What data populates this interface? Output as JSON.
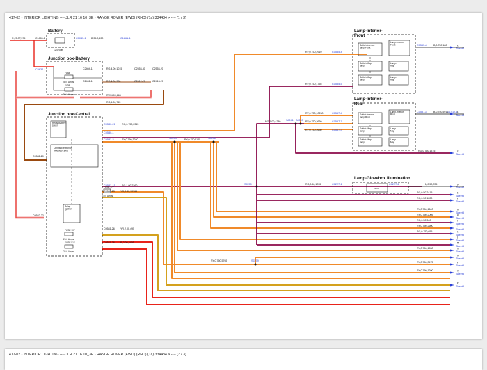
{
  "pages": [
    {
      "header": "417-02 - INTERIOR LIGHTING ---- JLR 21 16 10_3E - RANGE ROVER (EWD) (RHD) (1a) 334434 > ---- (1 / 3)"
    },
    {
      "header": "417-02 - INTERIOR LIGHTING ---- JLR 21 16 10_3E - RANGE ROVER (EWD) (RHD) (1a) 334434 > ---- (2 / 3)"
    }
  ],
  "blocks": {
    "battery": "Battery",
    "jbox_battery": "Junction box-Battery",
    "jbox_central": "Junction box-Central",
    "lamp_front": "Lamp-Interior-\nFront",
    "lamp_rear": "Lamp-Interior-\nRear",
    "lamp_glovebox": "Lamp-Glovebox illumination"
  },
  "components": {
    "relay_battery_saver": "Relay-Battery-\nsaver",
    "cem": "Central Electronics\nModule (CEM)",
    "relay_ignition": "Relay-\nIgnition",
    "sw_front_lamp": "Switch-Interior-\nlamp-Front",
    "sw_map_1": "Switch-Map-\nlamp",
    "lamp_map_1": "Lamp-\nMap",
    "sw_map_2": "Switch-Map-\nlamp",
    "lamp_map_2": "Lamp-\nMap",
    "lamp_front_inner": "Lamp-Interior-\nFront",
    "sw_rear_lamp": "Switch-Interior-\nlamp-Rear",
    "lamp_rear_inner": "Lamp-Interior-\nRear",
    "sw_map_3": "Switch-Map-\nlamp",
    "lamp_map_3": "Lamp-\nMap",
    "sw_map_4": "Switch-Map-\nlamp",
    "lamp_map_4": "Lamp-\nMap",
    "glovebox_lamp": "Lamp"
  },
  "fuses": {
    "f48": "FL48",
    "f48_rating": "40.0 Amps",
    "f38": "FL38",
    "f38_rating": "50.0 Amps",
    "f17f": "FUSE 17F",
    "f17f_rating": "10.0 Amps",
    "f10f": "FUSE 10F",
    "f10f_rating": "25.0 Amps",
    "f51f": "FUSE 51F",
    "f51f_rating": "25.0 Amps",
    "battery_rating": "12.0 Volts"
  },
  "connectors": {
    "c1": "C1889-1",
    "c2": "C0045-1",
    "c3": "C1861-1",
    "c4": "C0632-1",
    "c5": "C2404-1",
    "c6": "C2402-1",
    "c7": "C0580-26",
    "c8": "C0580-1",
    "c9": "C0582-2",
    "c10": "C0582-15",
    "c11": "C0580-23",
    "c12": "C0581-26",
    "c13": "C0581-36",
    "c14": "C0582-20",
    "c15": "C0582-22",
    "c16": "C0555-4",
    "c17": "C0555-5",
    "c18": "C0555-8",
    "c19": "C0557-4",
    "c20": "C0557-7",
    "c21": "C0557-3",
    "c22": "C0557-8",
    "c23": "C1412-1",
    "c24": "C0227-1",
    "c25": "C0227-2",
    "c26": "C2553-30",
    "c27": "C2412-20",
    "c28": "C2553-20",
    "c29": "C2413-20"
  },
  "splices": {
    "s1": "SJ254",
    "s2": "SJ256",
    "s3": "SJ243",
    "s4": "SJ241",
    "s5": "SJ250",
    "s6": "SJ279"
  },
  "wires": {
    "w1": "R,25.0F,375",
    "w2": "B,35.0,430",
    "w3": "RG,4.00,1015",
    "w4": "RG,4.00,950",
    "w5": "RW,4.00,665",
    "w6": "RG,4.00,745",
    "w7": "RG,0.750,2315",
    "w8": "RY,0.750,3280",
    "w9": "RY,0.750,1125",
    "w10": "RG,1.00,2260",
    "w11": "YO,0.50,10765",
    "w12": "YR,2.00,495",
    "w13": "R,2.00,2495",
    "w14": "RY,0.750,2910",
    "w15": "RY,0.750,1755",
    "w16": "B,0.750,180",
    "w17": "RG,1.00,4280",
    "w18": "RY,0.750,10230",
    "w19": "RY,0.750,2630",
    "w20": "RY,0.750,2630",
    "w21": "B,0.750,5910",
    "w22": "RG,0.750,1375",
    "w23": "RG,0.50,1765",
    "w24": "B,0.50,725",
    "w25": "RY,0.750,5765",
    "w26": "RG,0.50,2415",
    "w27": "RG,0.50,1220",
    "w28": "RY,0.750,1640",
    "w29": "RY,0.750,2005",
    "w30": "RG,0.50,340",
    "w31": "RY,0.750,2600",
    "w32": "RG,0.750,655",
    "w33": "RY,0.750,1530",
    "w34": "RY,0.750,3475",
    "w35": "RY,0.750,1290"
  },
  "sheets": {
    "sheet_ref": "Sheet3",
    "letters": [
      "A",
      "B",
      "C",
      "D",
      "E",
      "F",
      "G",
      "H",
      "I",
      "J",
      "K",
      "L",
      "M",
      "N",
      "O",
      "P",
      "Q",
      "R"
    ]
  },
  "colors": {
    "red": "#e8231a",
    "orange": "#f08a2a",
    "maroon": "#8b0a4a",
    "brown": "#9a4a10",
    "gold": "#d4a11e",
    "pink": "#f2a6a6",
    "black": "#111111"
  }
}
